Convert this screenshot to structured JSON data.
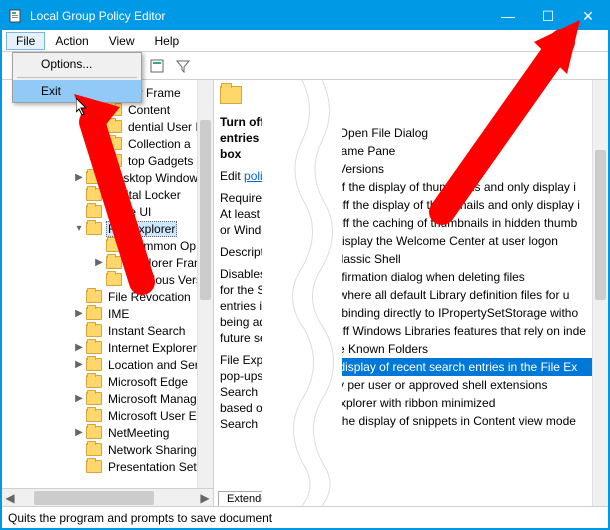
{
  "window": {
    "title": "Local Group Policy Editor",
    "buttons": {
      "min": "—",
      "max": "☐",
      "close": "✕"
    }
  },
  "menubar": {
    "file": "File",
    "action": "Action",
    "view": "View",
    "help": "Help"
  },
  "dropdown": {
    "options": "Options...",
    "exit": "Exit"
  },
  "tree": {
    "items": [
      {
        "label": "Explorer Frame",
        "indent": 60,
        "twisty": "",
        "vis": false
      },
      {
        "label": "Content",
        "indent": 90,
        "twisty": ""
      },
      {
        "label": "dential User In",
        "indent": 90,
        "twisty": ""
      },
      {
        "label": "Collection a",
        "indent": 90,
        "twisty": "▶"
      },
      {
        "label": "top Gadgets",
        "indent": 90,
        "twisty": ""
      },
      {
        "label": "Desktop Window",
        "indent": 70,
        "twisty": "▶"
      },
      {
        "label": "Digital Locker",
        "indent": 70,
        "twisty": ""
      },
      {
        "label": "Edge UI",
        "indent": 70,
        "twisty": ""
      },
      {
        "label": "File Explorer",
        "indent": 70,
        "twisty": "▾",
        "sel": true
      },
      {
        "label": "Common Op",
        "indent": 90,
        "twisty": ""
      },
      {
        "label": "Explorer Fram",
        "indent": 90,
        "twisty": "▶"
      },
      {
        "label": "Previous Vers",
        "indent": 90,
        "twisty": ""
      },
      {
        "label": "File Revocation",
        "indent": 70,
        "twisty": ""
      },
      {
        "label": "IME",
        "indent": 70,
        "twisty": "▶"
      },
      {
        "label": "Instant Search",
        "indent": 70,
        "twisty": ""
      },
      {
        "label": "Internet Explorer",
        "indent": 70,
        "twisty": "▶"
      },
      {
        "label": "Location and Ser",
        "indent": 70,
        "twisty": "▶"
      },
      {
        "label": "Microsoft Edge",
        "indent": 70,
        "twisty": ""
      },
      {
        "label": "Microsoft Manag",
        "indent": 70,
        "twisty": "▶"
      },
      {
        "label": "Microsoft User Ex",
        "indent": 70,
        "twisty": ""
      },
      {
        "label": "NetMeeting",
        "indent": 70,
        "twisty": "▶"
      },
      {
        "label": "Network Sharing",
        "indent": 70,
        "twisty": ""
      },
      {
        "label": "Presentation Sett",
        "indent": 70,
        "twisty": ""
      }
    ]
  },
  "mid": {
    "heading_line1": "Turn off",
    "heading_line2": "entries in",
    "heading_line3": "box",
    "edit": "Edit",
    "edit_link": "policy",
    "req_line1": "Required",
    "req_line2": "At least",
    "req_line3": "or Windows",
    "desc": "Description:",
    "desc_line1": "Disables s",
    "desc_line2": "for the Se",
    "desc_line3": "entries int",
    "desc_line4": "being add",
    "desc_line5": "future sea",
    "f_line1": "File Explo",
    "f_line2": "pop-ups a",
    "f_line3": "Search Bo",
    "f_line4": "based on",
    "f_line5": "Search Bo",
    "bottab": "Extended"
  },
  "right": {
    "items": [
      "on Open File Dialog",
      "r Frame Pane",
      "us Versions",
      "n off the display of thumbnails and only display i",
      "rn off the display of thumbnails and only display i",
      "rn off the caching of thumbnails in hidden thumb",
      "ot display the Welcome Center at user logon",
      "n Classic Shell",
      "confirmation dialog when deleting files",
      "on where all default Library definition files for u",
      "ble binding directly to IPropertySetStorage witho",
      "rn off Windows Libraries features that rely on inde",
      "able Known Folders",
      " off display of recent search entries in the File Ex",
      "only per user or approved shell extensions",
      "e Explorer with ribbon minimized",
      "off the display of snippets in Content view mode"
    ],
    "selected_index": 13
  },
  "statusbar": "Quits the program and prompts to save document",
  "hscroll": {
    "left": "◀",
    "right": "▶"
  }
}
